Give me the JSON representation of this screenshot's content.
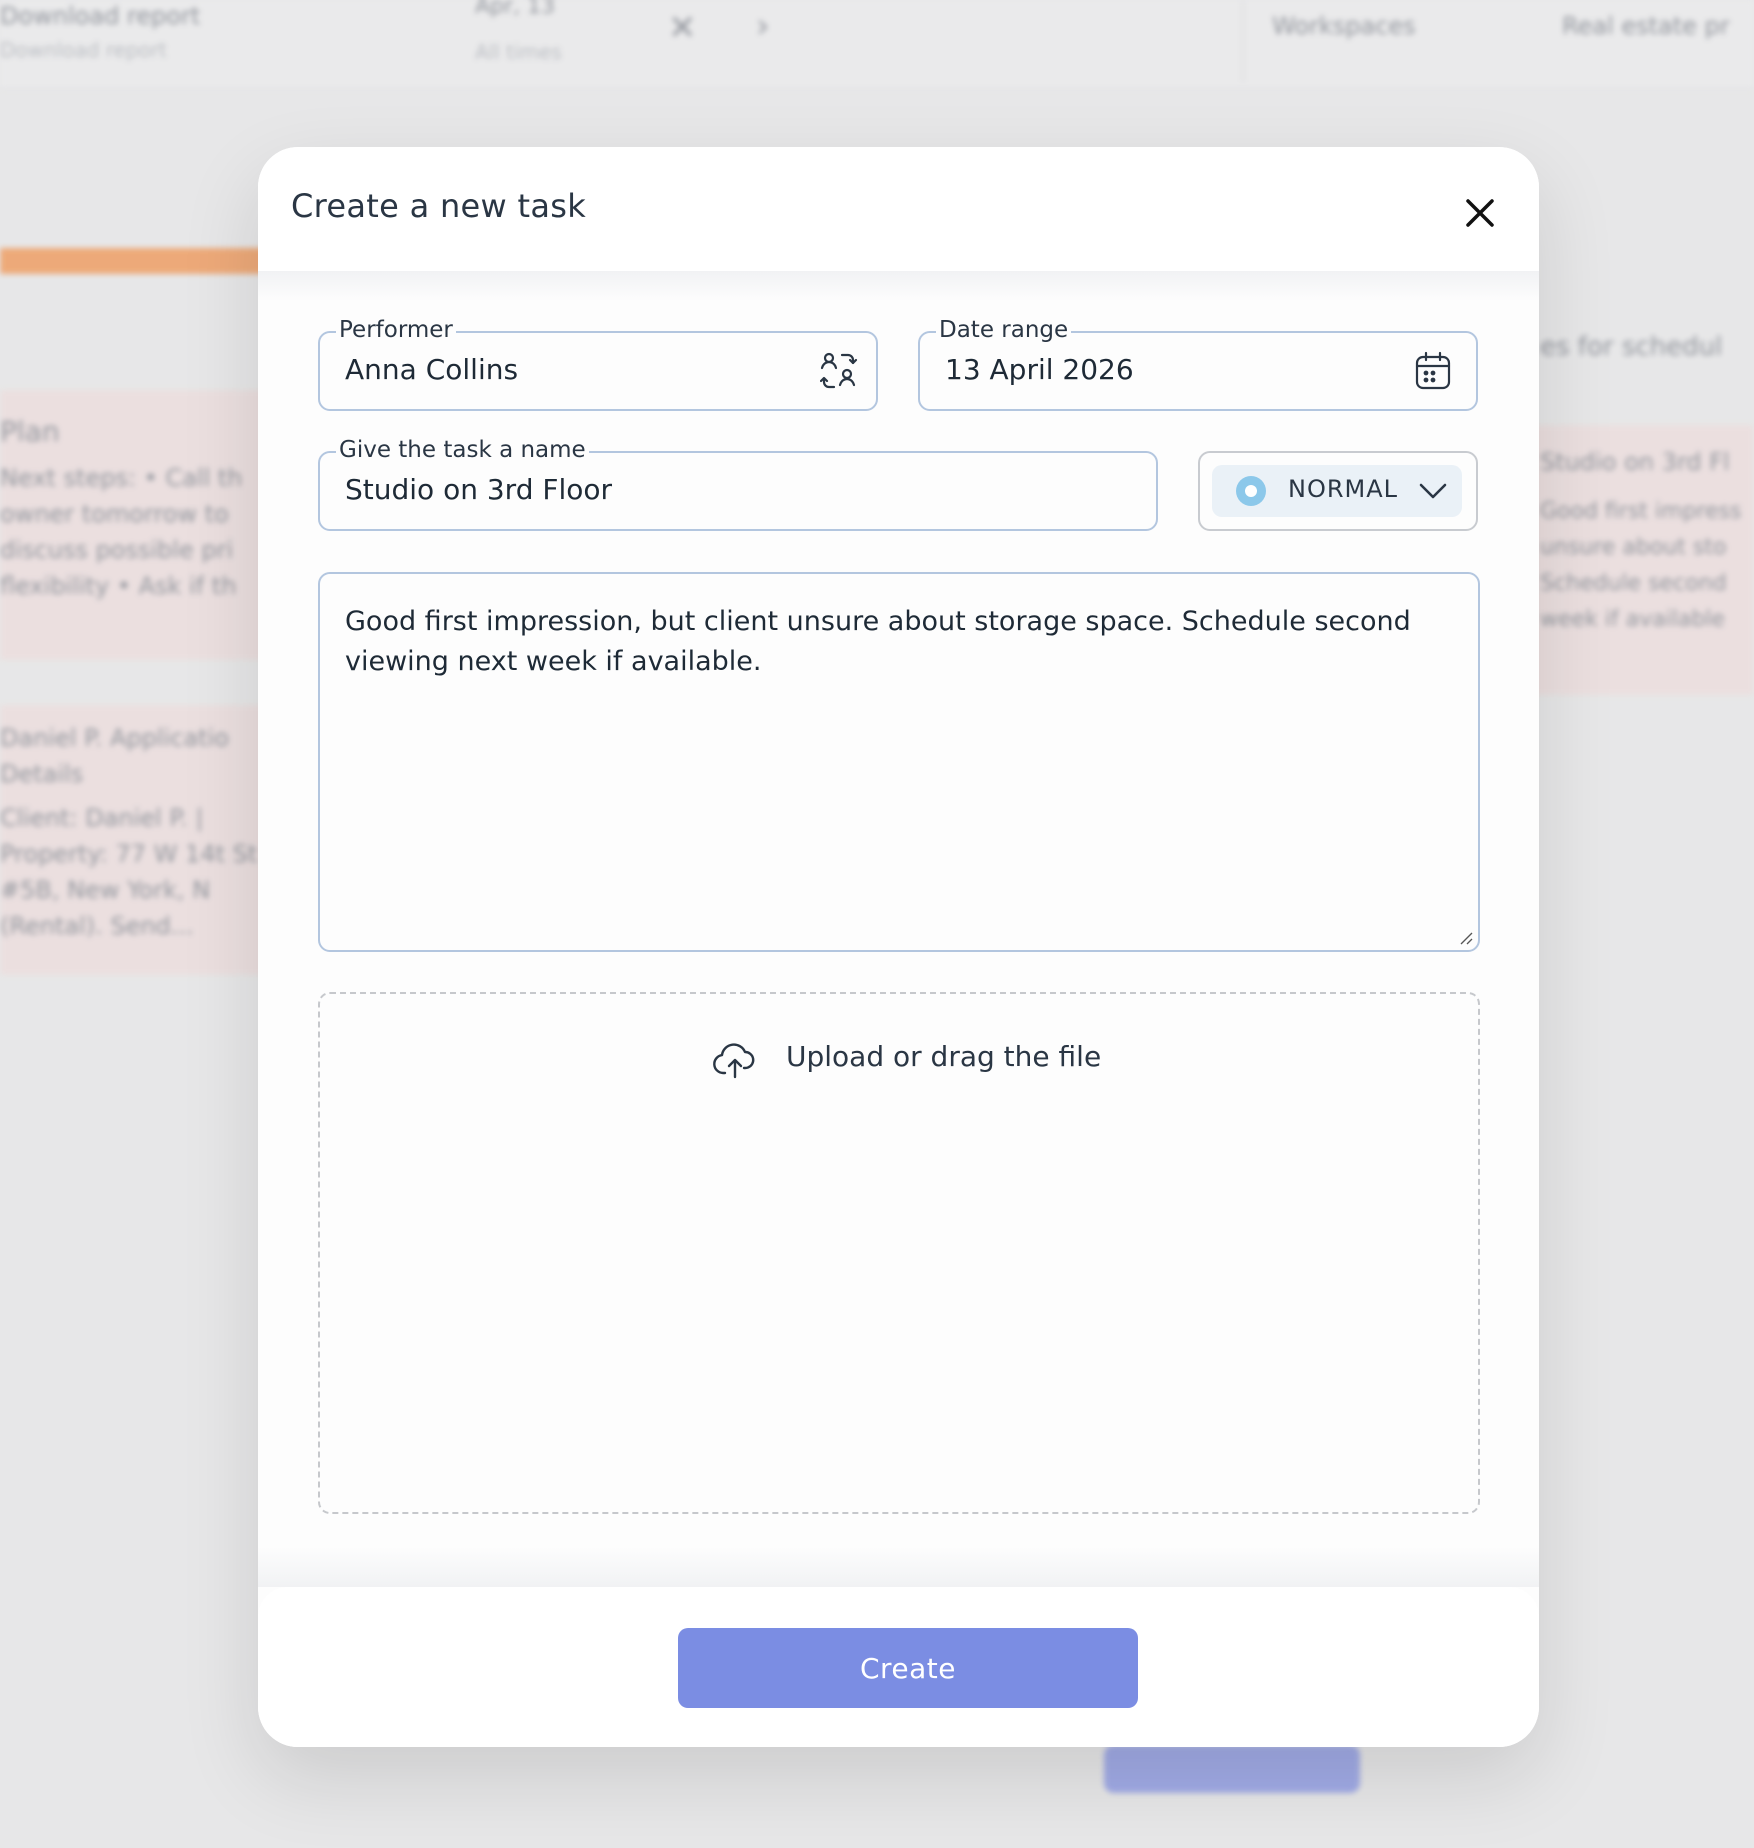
{
  "background": {
    "top_left_title": "Download report",
    "top_left_subtitle": "Download report",
    "top_date": "Apr, 13",
    "top_time": "All times",
    "top_workspaces": "Workspaces",
    "top_realestate": "Real estate pr",
    "left_card_title": "Plan",
    "left_card_text": "Next steps: • Call th owner tomorrow to discuss possible pri flexibility • Ask if th",
    "left_card2_title": "Daniel P. Applicatio Details",
    "left_card2_text": "Client: Daniel P. | Property: 77 W 14t St #5B, New York, N (Rental). Send...",
    "right_hint": "es for schedul",
    "right_card_title": "Studio on 3rd Fl",
    "right_card_text": "Good first impress unsure about sto Schedule second week if available"
  },
  "modal": {
    "title": "Create a new task",
    "close_icon": "close-icon",
    "performer": {
      "label": "Performer",
      "value": "Anna Collins",
      "icon": "swap-users-icon"
    },
    "date_range": {
      "label": "Date range",
      "value": "13 April 2026",
      "icon": "calendar-icon"
    },
    "task_name": {
      "label": "Give the task a name",
      "value": "Studio on 3rd Floor"
    },
    "priority": {
      "value": "NORMAL",
      "dot_color": "#8cc8ea",
      "icon": "chevron-down-icon"
    },
    "description": "Good first impression, but client unsure about storage space. Schedule second viewing next week if available.",
    "upload": {
      "label": "Upload or drag the file",
      "icon": "cloud-upload-icon"
    },
    "create_button": "Create",
    "accent_color": "#7b8de3"
  }
}
